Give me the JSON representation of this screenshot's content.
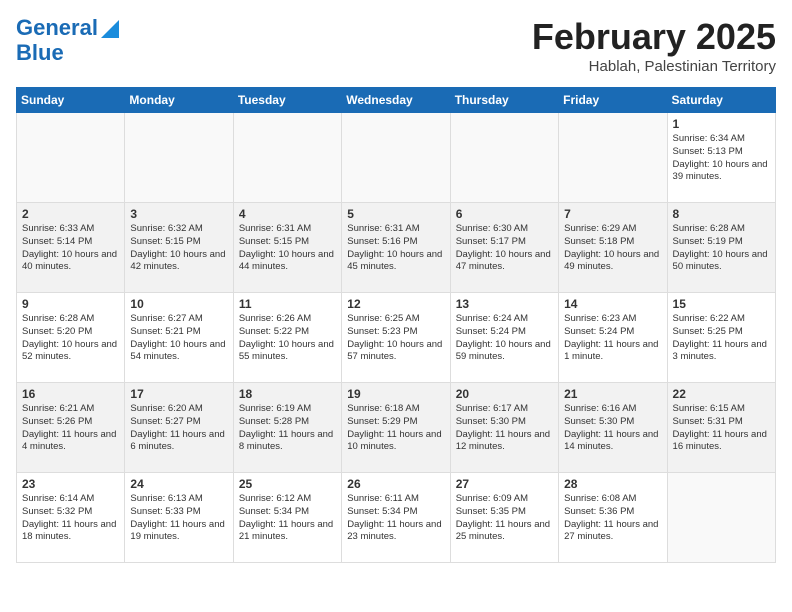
{
  "header": {
    "logo_line1": "General",
    "logo_line2": "Blue",
    "month": "February 2025",
    "location": "Hablah, Palestinian Territory"
  },
  "weekdays": [
    "Sunday",
    "Monday",
    "Tuesday",
    "Wednesday",
    "Thursday",
    "Friday",
    "Saturday"
  ],
  "weeks": [
    [
      {
        "day": "",
        "info": ""
      },
      {
        "day": "",
        "info": ""
      },
      {
        "day": "",
        "info": ""
      },
      {
        "day": "",
        "info": ""
      },
      {
        "day": "",
        "info": ""
      },
      {
        "day": "",
        "info": ""
      },
      {
        "day": "1",
        "info": "Sunrise: 6:34 AM\nSunset: 5:13 PM\nDaylight: 10 hours and 39 minutes."
      }
    ],
    [
      {
        "day": "2",
        "info": "Sunrise: 6:33 AM\nSunset: 5:14 PM\nDaylight: 10 hours and 40 minutes."
      },
      {
        "day": "3",
        "info": "Sunrise: 6:32 AM\nSunset: 5:15 PM\nDaylight: 10 hours and 42 minutes."
      },
      {
        "day": "4",
        "info": "Sunrise: 6:31 AM\nSunset: 5:15 PM\nDaylight: 10 hours and 44 minutes."
      },
      {
        "day": "5",
        "info": "Sunrise: 6:31 AM\nSunset: 5:16 PM\nDaylight: 10 hours and 45 minutes."
      },
      {
        "day": "6",
        "info": "Sunrise: 6:30 AM\nSunset: 5:17 PM\nDaylight: 10 hours and 47 minutes."
      },
      {
        "day": "7",
        "info": "Sunrise: 6:29 AM\nSunset: 5:18 PM\nDaylight: 10 hours and 49 minutes."
      },
      {
        "day": "8",
        "info": "Sunrise: 6:28 AM\nSunset: 5:19 PM\nDaylight: 10 hours and 50 minutes."
      }
    ],
    [
      {
        "day": "9",
        "info": "Sunrise: 6:28 AM\nSunset: 5:20 PM\nDaylight: 10 hours and 52 minutes."
      },
      {
        "day": "10",
        "info": "Sunrise: 6:27 AM\nSunset: 5:21 PM\nDaylight: 10 hours and 54 minutes."
      },
      {
        "day": "11",
        "info": "Sunrise: 6:26 AM\nSunset: 5:22 PM\nDaylight: 10 hours and 55 minutes."
      },
      {
        "day": "12",
        "info": "Sunrise: 6:25 AM\nSunset: 5:23 PM\nDaylight: 10 hours and 57 minutes."
      },
      {
        "day": "13",
        "info": "Sunrise: 6:24 AM\nSunset: 5:24 PM\nDaylight: 10 hours and 59 minutes."
      },
      {
        "day": "14",
        "info": "Sunrise: 6:23 AM\nSunset: 5:24 PM\nDaylight: 11 hours and 1 minute."
      },
      {
        "day": "15",
        "info": "Sunrise: 6:22 AM\nSunset: 5:25 PM\nDaylight: 11 hours and 3 minutes."
      }
    ],
    [
      {
        "day": "16",
        "info": "Sunrise: 6:21 AM\nSunset: 5:26 PM\nDaylight: 11 hours and 4 minutes."
      },
      {
        "day": "17",
        "info": "Sunrise: 6:20 AM\nSunset: 5:27 PM\nDaylight: 11 hours and 6 minutes."
      },
      {
        "day": "18",
        "info": "Sunrise: 6:19 AM\nSunset: 5:28 PM\nDaylight: 11 hours and 8 minutes."
      },
      {
        "day": "19",
        "info": "Sunrise: 6:18 AM\nSunset: 5:29 PM\nDaylight: 11 hours and 10 minutes."
      },
      {
        "day": "20",
        "info": "Sunrise: 6:17 AM\nSunset: 5:30 PM\nDaylight: 11 hours and 12 minutes."
      },
      {
        "day": "21",
        "info": "Sunrise: 6:16 AM\nSunset: 5:30 PM\nDaylight: 11 hours and 14 minutes."
      },
      {
        "day": "22",
        "info": "Sunrise: 6:15 AM\nSunset: 5:31 PM\nDaylight: 11 hours and 16 minutes."
      }
    ],
    [
      {
        "day": "23",
        "info": "Sunrise: 6:14 AM\nSunset: 5:32 PM\nDaylight: 11 hours and 18 minutes."
      },
      {
        "day": "24",
        "info": "Sunrise: 6:13 AM\nSunset: 5:33 PM\nDaylight: 11 hours and 19 minutes."
      },
      {
        "day": "25",
        "info": "Sunrise: 6:12 AM\nSunset: 5:34 PM\nDaylight: 11 hours and 21 minutes."
      },
      {
        "day": "26",
        "info": "Sunrise: 6:11 AM\nSunset: 5:34 PM\nDaylight: 11 hours and 23 minutes."
      },
      {
        "day": "27",
        "info": "Sunrise: 6:09 AM\nSunset: 5:35 PM\nDaylight: 11 hours and 25 minutes."
      },
      {
        "day": "28",
        "info": "Sunrise: 6:08 AM\nSunset: 5:36 PM\nDaylight: 11 hours and 27 minutes."
      },
      {
        "day": "",
        "info": ""
      }
    ]
  ]
}
